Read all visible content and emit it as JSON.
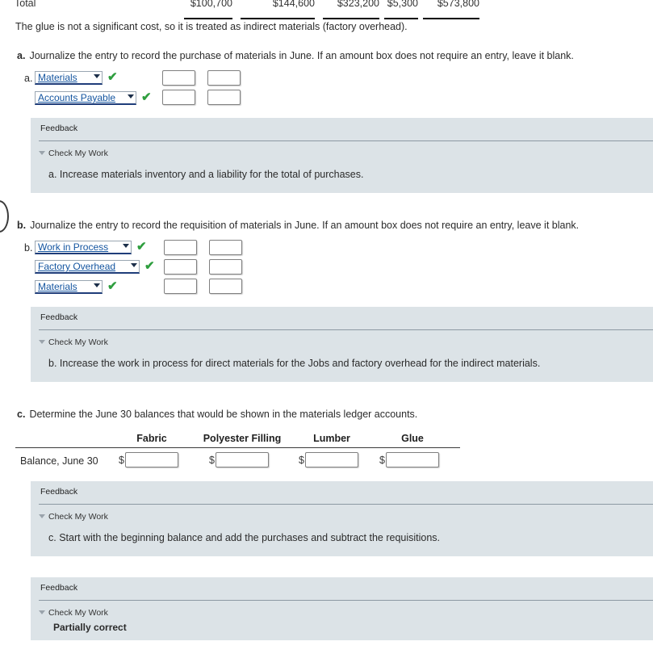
{
  "total_row": {
    "label": "Total",
    "values": [
      "$100,700",
      "$144,600",
      "$323,200",
      "$5,300",
      "$573,800"
    ]
  },
  "note": "The glue is not a significant cost, so it is treated as indirect materials (factory overhead).",
  "requirements": [
    {
      "letter": "a.",
      "text": "Journalize the entry to record the purchase of materials in June. If an amount box does not require an entry, leave it blank."
    },
    {
      "letter": "b.",
      "text": "Journalize the entry to record the requisition of materials in June. If an amount box does not require an entry, leave it blank."
    },
    {
      "letter": "c.",
      "text": "Determine the June 30 balances that would be shown in the materials ledger accounts."
    }
  ],
  "entry_a": {
    "row_letter": "a.",
    "rows": [
      {
        "account": "Materials",
        "debit": "",
        "credit": "",
        "status": "✔"
      },
      {
        "account": "Accounts Payable",
        "debit": "",
        "credit": "",
        "status": "✔"
      }
    ]
  },
  "entry_b": {
    "row_letter": "b.",
    "rows": [
      {
        "account": "Work in Process",
        "debit": "",
        "credit": "",
        "status": "✔"
      },
      {
        "account": "Factory Overhead",
        "debit": "",
        "credit": "",
        "status": "✔"
      },
      {
        "account": "Materials",
        "debit": "",
        "credit": "",
        "status": "✔"
      }
    ]
  },
  "ledger": {
    "columns": [
      "Fabric",
      "Polyester Filling",
      "Lumber",
      "Glue"
    ],
    "row_label": "Balance, June 30",
    "currency_symbol": "$",
    "values": [
      "",
      "",
      "",
      ""
    ]
  },
  "feedback_sections": [
    {
      "title": "Feedback",
      "toggle_label": "Check My Work",
      "body": "a. Increase materials inventory and a liability for the total of purchases."
    },
    {
      "title": "Feedback",
      "toggle_label": "Check My Work",
      "body": "b. Increase the work in process for direct materials for the Jobs and factory overhead for the indirect materials."
    },
    {
      "title": "Feedback",
      "toggle_label": "Check My Work",
      "body": "c. Start with the beginning balance and add the purchases and subtract the requisitions."
    },
    {
      "title": "Feedback",
      "toggle_label": "Check My Work",
      "body": "Partially correct"
    }
  ],
  "colors": {
    "feedback_bg": "#dce3e7",
    "check_green": "#2e9e3e",
    "select_text": "#1455a0"
  }
}
